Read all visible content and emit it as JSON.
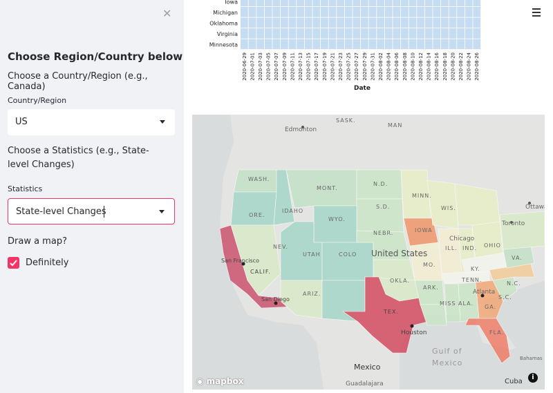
{
  "sidebar": {
    "close_glyph": "✕",
    "title": "Choose Region/Country below",
    "subtitle": "Choose a Country/Region (e.g., Canada)",
    "country_label": "Country/Region",
    "country_value": "US",
    "stat_question": "Choose a Statistics (e.g., State-level Changes)",
    "stat_label": "Statistics",
    "stat_value": "State-level Changes",
    "map_question": "Draw a map?",
    "checkbox_label": "Definitely"
  },
  "colors": {
    "accent": "#f63366",
    "sidebar_bg": "#f0f2f6",
    "heat_cell": "#c6dcf0"
  },
  "heatmap": {
    "states": [
      "Iowa",
      "Michigan",
      "Oklahoma",
      "Virginia",
      "Minnesota"
    ],
    "dates": [
      "2020-06-29",
      "2020-07-01",
      "2020-07-03",
      "2020-07-05",
      "2020-07-07",
      "2020-07-09",
      "2020-07-11",
      "2020-07-13",
      "2020-07-15",
      "2020-07-17",
      "2020-07-19",
      "2020-07-21",
      "2020-07-23",
      "2020-07-25",
      "2020-07-27",
      "2020-07-29",
      "2020-07-31",
      "2020-08-02",
      "2020-08-04",
      "2020-08-06",
      "2020-08-08",
      "2020-08-10",
      "2020-08-12",
      "2020-08-14",
      "2020-08-16",
      "2020-08-18",
      "2020-08-20",
      "2020-08-22",
      "2020-08-24",
      "2020-08-26"
    ],
    "xlabel": "Date"
  },
  "map": {
    "labels": {
      "edmonton": "Edmonton",
      "sask": "SASK.",
      "man": "MAN",
      "wash": "WASH.",
      "mont": "MONT.",
      "nd": "N.D.",
      "minn": "MINN.",
      "ore": "ORE.",
      "idaho": "IDAHO",
      "sd": "S.D.",
      "wis": "WIS.",
      "ottawa": "Ottawa",
      "wyo": "WYO.",
      "iowa": "IOWA",
      "toronto": "Toronto",
      "nebr": "NEBR.",
      "chicago": "Chicago",
      "nev": "NEV.",
      "utah": "UTAH",
      "colo": "COLO",
      "us": "United States",
      "ill": "ILL.",
      "ind": "IND.",
      "ohio": "OHIO",
      "sanfrancisco": "San Francisco",
      "calif": "CALIF.",
      "mo": "MO.",
      "ky": "KY.",
      "va": "VA.",
      "okla": "OKLA.",
      "ariz": "ARIZ.",
      "ark": "ARK.",
      "tenn": "TENN.",
      "nc": "N.C.",
      "sandiego": "San Diego",
      "atlanta": "Atlanta",
      "miss": "MISS",
      "ala": "ALA.",
      "ga": "GA.",
      "sc": "S.C.",
      "tex": "TEX.",
      "houston": "Houston",
      "fla": "FLA.",
      "gulf1": "Gulf of",
      "gulf2": "Mexico",
      "mexico": "Mexico",
      "bahamas": "Bahamas",
      "guadalajara": "Guadalajara",
      "cuba": "Cuba",
      "mapbox": "mapbox",
      "info": "i"
    }
  }
}
